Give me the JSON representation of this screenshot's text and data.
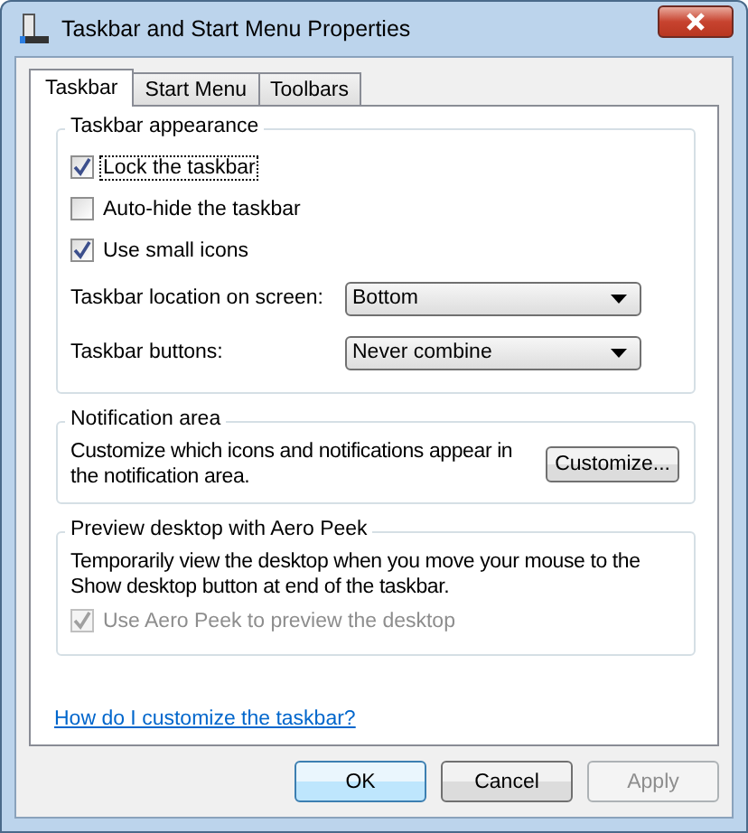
{
  "window": {
    "title": "Taskbar and Start Menu Properties"
  },
  "tabs": [
    {
      "label": "Taskbar",
      "selected": true
    },
    {
      "label": "Start Menu",
      "selected": false
    },
    {
      "label": "Toolbars",
      "selected": false
    }
  ],
  "groups": [
    {
      "title": "Taskbar appearance",
      "checkboxes": [
        {
          "label": "Lock the taskbar",
          "checked": true,
          "focused": true,
          "disabled": false
        },
        {
          "label": "Auto-hide the taskbar",
          "checked": false,
          "focused": false,
          "disabled": false
        },
        {
          "label": "Use small icons",
          "checked": true,
          "focused": false,
          "disabled": false
        }
      ],
      "dropdowns": [
        {
          "label": "Taskbar location on screen:",
          "value": "Bottom"
        },
        {
          "label": "Taskbar buttons:",
          "value": "Never combine"
        }
      ]
    },
    {
      "title": "Notification area",
      "text": "Customize which icons and notifications appear in the notification area.",
      "button": "Customize..."
    },
    {
      "title": "Preview desktop with Aero Peek",
      "text": "Temporarily view the desktop when you move your mouse to the Show desktop button at end of the taskbar.",
      "checkboxes": [
        {
          "label": "Use Aero Peek to preview the desktop",
          "checked": true,
          "focused": false,
          "disabled": true
        }
      ]
    }
  ],
  "help_link": "How do I customize the taskbar?",
  "buttons": [
    {
      "label": "OK",
      "default": true,
      "disabled": false
    },
    {
      "label": "Cancel",
      "default": false,
      "disabled": false
    },
    {
      "label": "Apply",
      "default": false,
      "disabled": true
    }
  ]
}
